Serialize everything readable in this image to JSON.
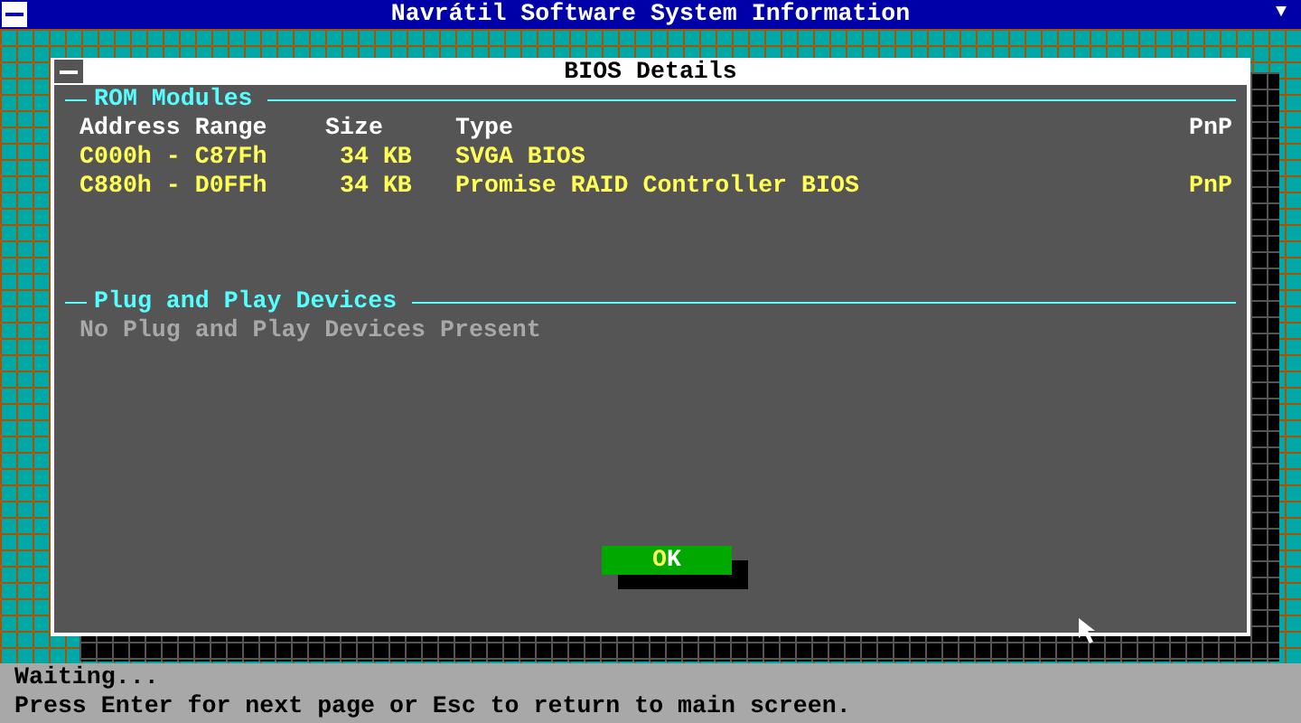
{
  "window": {
    "title": "Navrátil Software System Information",
    "scroll_arrow": "▼"
  },
  "dialog": {
    "title": "BIOS Details",
    "sections": [
      {
        "kind": "table",
        "title": "ROM Modules",
        "columns": [
          "Address Range",
          "Size",
          "Type",
          "PnP"
        ],
        "rows": [
          {
            "cells": [
              "C000h - C87Fh",
              "34 KB",
              "SVGA BIOS",
              ""
            ]
          },
          {
            "cells": [
              "C880h - D0FFh",
              "34 KB",
              "Promise RAID Controller BIOS",
              "PnP"
            ]
          }
        ]
      },
      {
        "kind": "message",
        "title": "Plug and Play Devices",
        "message": "No Plug and Play Devices Present",
        "disabled": true
      }
    ],
    "button": {
      "label_parts": [
        {
          "text": "O",
          "hotkey": true
        },
        {
          "text": "K",
          "hotkey": false
        }
      ]
    }
  },
  "status_bar": [
    "Waiting...",
    "Press Enter for next page or Esc to return to main screen."
  ]
}
